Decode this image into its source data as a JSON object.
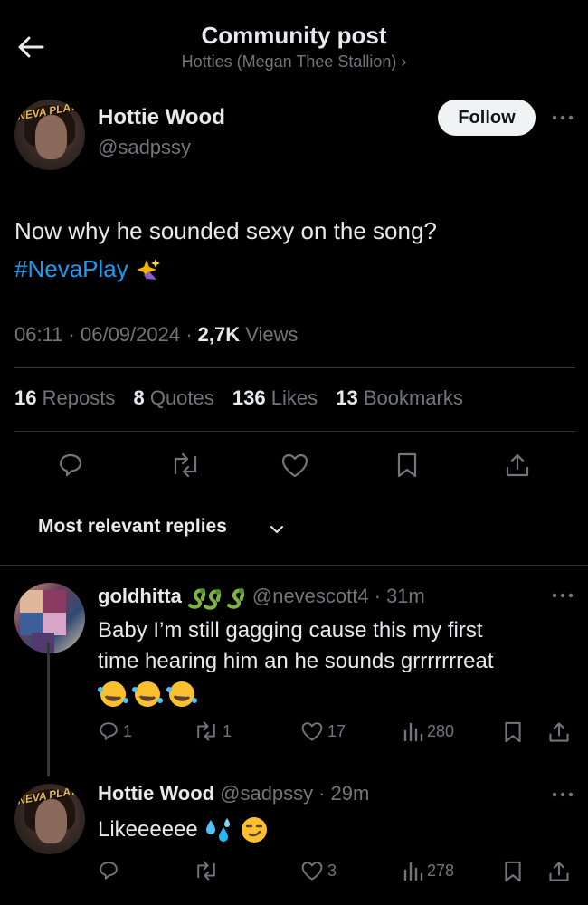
{
  "header": {
    "title": "Community post",
    "subtitle": "Hotties (Megan Thee Stallion) ›"
  },
  "post": {
    "author_name": "Hottie Wood",
    "author_handle": "@sadpssy",
    "avatar_badge": "NEVA PLAY",
    "follow_label": "Follow",
    "text": "Now why he sounded sexy on the song?",
    "hashtag": "#NevaPlay",
    "time": "06:11",
    "date": "06/09/2024",
    "views_count": "2,7K",
    "views_label": "Views",
    "stats": [
      {
        "count": "16",
        "label": "Reposts"
      },
      {
        "count": "8",
        "label": "Quotes"
      },
      {
        "count": "136",
        "label": "Likes"
      },
      {
        "count": "13",
        "label": "Bookmarks"
      }
    ]
  },
  "replies_filter": "Most relevant replies",
  "replies": [
    {
      "name": "goldhitta",
      "handle": "@nevescott4",
      "time": "31m",
      "text_line1": "Baby I’m still gagging cause this my first",
      "text_line2": "time hearing him an he sounds grrrrrrreat",
      "reply_count": "1",
      "repost_count": "1",
      "like_count": "17",
      "views_count": "280"
    },
    {
      "name": "Hottie Wood",
      "handle": "@sadpssy",
      "time": "29m",
      "text": "Likeeeeee",
      "avatar_badge": "NEVA PLAY",
      "like_count": "3",
      "views_count": "278"
    }
  ],
  "colors": {
    "background": "#000000",
    "text": "#e7e9ea",
    "muted": "#71767b",
    "link": "#1d9bf0",
    "divider": "#2f3336"
  },
  "icons": [
    "back-arrow-icon",
    "more-icon",
    "reply-icon",
    "repost-icon",
    "like-icon",
    "bookmark-icon",
    "share-icon",
    "views-icon",
    "chevron-down-icon",
    "snake-emoji",
    "rofl-emoji",
    "sweat-droplets-emoji",
    "smirk-emoji",
    "sparkle-emoji"
  ]
}
